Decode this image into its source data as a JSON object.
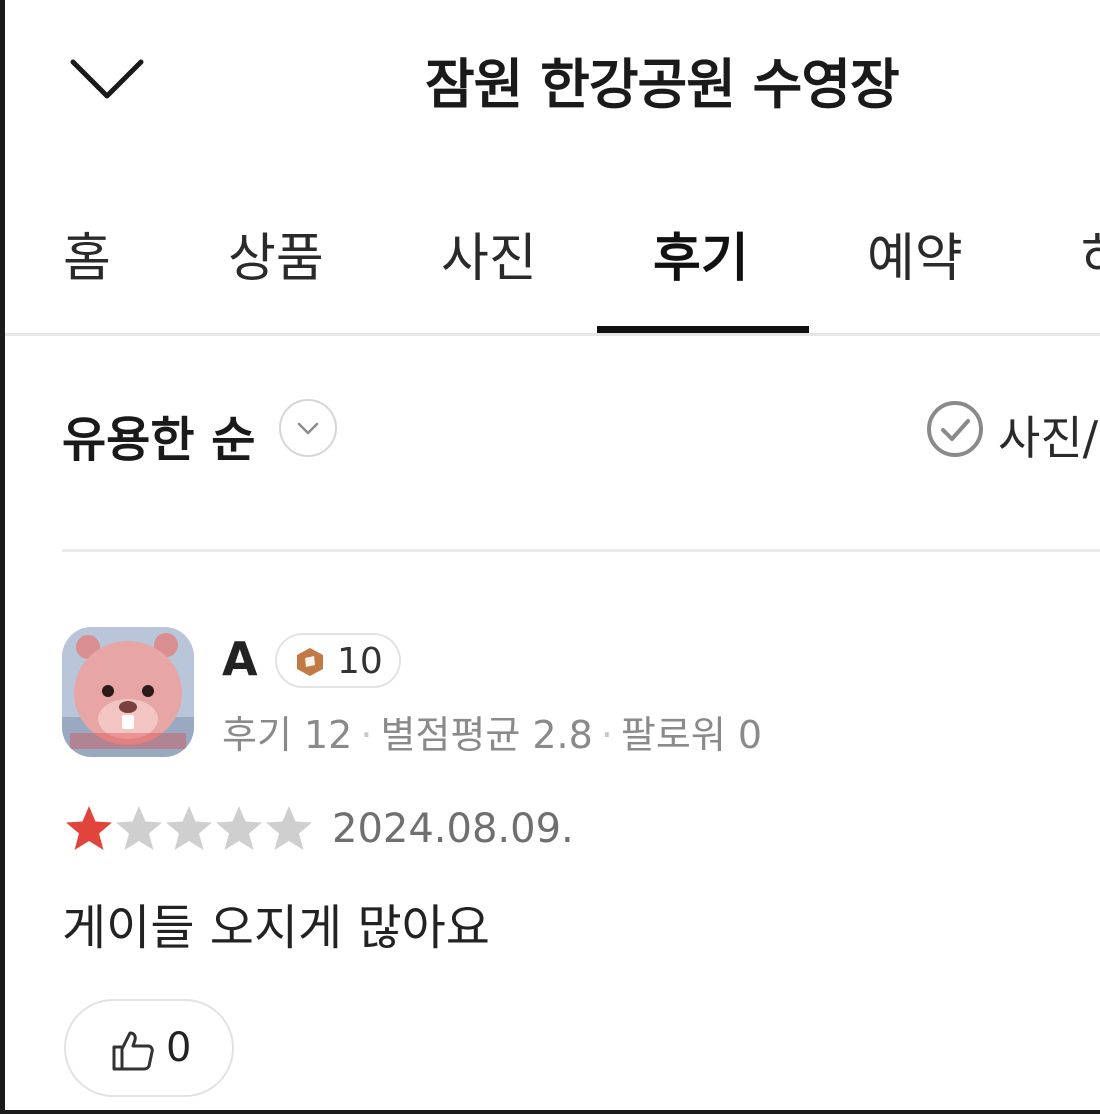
{
  "header": {
    "title": "잠원 한강공원 수영장"
  },
  "tabs": [
    {
      "label": "홈"
    },
    {
      "label": "상품"
    },
    {
      "label": "사진"
    },
    {
      "label": "후기",
      "active": true
    },
    {
      "label": "예약"
    },
    {
      "label": "하"
    }
  ],
  "toolbar": {
    "sort_label": "유용한 순",
    "filter_label": "사진/"
  },
  "review": {
    "reviewer_name": "A",
    "level": "10",
    "stats": {
      "reviews": "후기 12",
      "avg_rating": "별점평균 2.8",
      "followers": "팔로워 0"
    },
    "rating": 1,
    "rating_max": 5,
    "date": "2024.08.09.",
    "text": "게이들 오지게 많아요",
    "likes": "0"
  },
  "colors": {
    "star_filled": "#e0443a",
    "star_empty": "#cfcfcf",
    "badge": "#c17a45",
    "active_tab_underline": "#111111"
  }
}
